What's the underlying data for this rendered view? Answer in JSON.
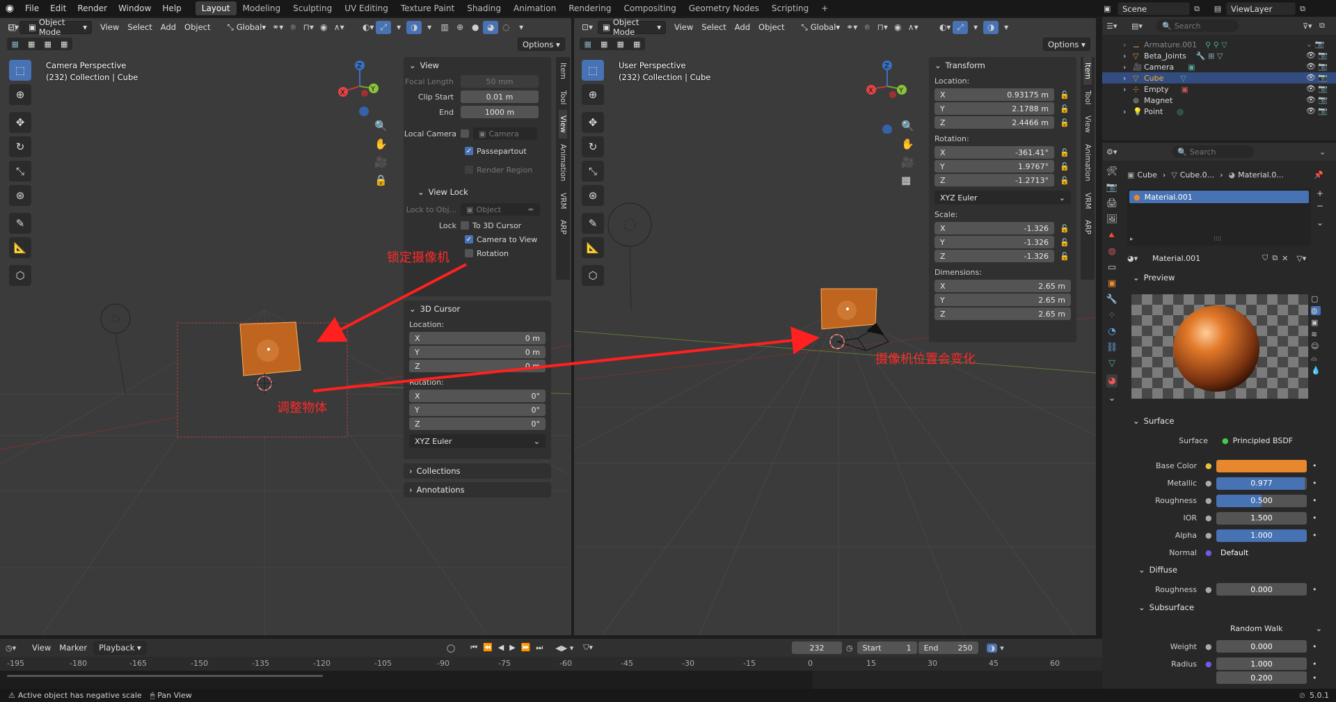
{
  "topbar": {
    "menus": [
      "File",
      "Edit",
      "Render",
      "Window",
      "Help"
    ],
    "workspaces": [
      "Layout",
      "Modeling",
      "Sculpting",
      "UV Editing",
      "Texture Paint",
      "Shading",
      "Animation",
      "Rendering",
      "Compositing",
      "Geometry Nodes",
      "Scripting"
    ],
    "active_workspace": "Layout",
    "add_tab": "+",
    "scene": "Scene",
    "view_layer": "ViewLayer"
  },
  "left_viewport": {
    "mode": "Object Mode",
    "menus": [
      "View",
      "Select",
      "Add",
      "Object"
    ],
    "orientation": "Global",
    "options": "Options",
    "info_line1": "Camera Perspective",
    "info_line2": "(232) Collection | Cube",
    "npanel": {
      "view_header": "View",
      "focal_length_label": "Focal Length",
      "focal_length": "50 mm",
      "clip_start_label": "Clip Start",
      "clip_start": "0.01 m",
      "end_label": "End",
      "end": "1000 m",
      "local_camera_label": "Local Camera",
      "camera_placeholder": "Camera",
      "passepartout": "Passepartout",
      "render_region": "Render Region",
      "view_lock_header": "View Lock",
      "lock_to_obj_label": "Lock to Obj...",
      "object_placeholder": "Object",
      "lock_label": "Lock",
      "to_3d_cursor": "To 3D Cursor",
      "camera_to_view": "Camera to View",
      "rotation": "Rotation",
      "cursor_header": "3D Cursor",
      "location_label": "Location:",
      "loc_x": "0 m",
      "loc_y": "0 m",
      "loc_z": "0 m",
      "rotation_label": "Rotation:",
      "rot_x": "0°",
      "rot_y": "0°",
      "rot_z": "0°",
      "euler": "XYZ Euler",
      "collections": "Collections",
      "annotations": "Annotations"
    },
    "tabs": [
      "Item",
      "Tool",
      "View",
      "Animation",
      "VRM",
      "ARP"
    ],
    "active_tab": "View"
  },
  "right_viewport": {
    "mode": "Object Mode",
    "menus": [
      "View",
      "Select",
      "Add",
      "Object"
    ],
    "orientation": "Global",
    "options": "Options",
    "info_line1": "User Perspective",
    "info_line2": "(232) Collection | Cube",
    "transform": {
      "header": "Transform",
      "location_label": "Location:",
      "loc_x": "0.93175 m",
      "loc_y": "2.1788 m",
      "loc_z": "2.4466 m",
      "rotation_label": "Rotation:",
      "rot_x": "-361.41°",
      "rot_y": "1.9767°",
      "rot_z": "-1.2713°",
      "euler": "XYZ Euler",
      "scale_label": "Scale:",
      "sc_x": "-1.326",
      "sc_y": "-1.326",
      "sc_z": "-1.326",
      "dim_label": "Dimensions:",
      "dim_x": "2.65 m",
      "dim_y": "2.65 m",
      "dim_z": "2.65 m"
    },
    "tabs": [
      "Item",
      "Tool",
      "View",
      "Animation",
      "VRM",
      "ARP"
    ],
    "active_tab": "Item"
  },
  "annotations": {
    "lock_camera": "锁定摄像机",
    "adjust_object": "调整物体",
    "camera_changes": "摄像机位置会变化"
  },
  "outliner": {
    "search_placeholder": "Search",
    "items": [
      "Armature.001",
      "Beta_Joints",
      "Camera",
      "Cube",
      "Empty",
      "Magnet",
      "Point"
    ],
    "selected": "Cube"
  },
  "properties": {
    "search_placeholder": "Search",
    "breadcrumb": [
      "Cube",
      "Cube.0...",
      "Material.0..."
    ],
    "material_slot": "Material.001",
    "material_name": "Material.001",
    "preview_header": "Preview",
    "surface_header": "Surface",
    "surface_label": "Surface",
    "surface_value": "Principled BSDF",
    "rows": [
      {
        "label": "Base Color",
        "value": "",
        "type": "color"
      },
      {
        "label": "Metallic",
        "value": "0.977",
        "type": "slider",
        "fill": 0.977
      },
      {
        "label": "Roughness",
        "value": "0.500",
        "type": "slider",
        "fill": 0.5
      },
      {
        "label": "IOR",
        "value": "1.500",
        "type": "plain"
      },
      {
        "label": "Alpha",
        "value": "1.000",
        "type": "slider",
        "fill": 1.0
      },
      {
        "label": "Normal",
        "value": "Default",
        "type": "text"
      }
    ],
    "diffuse_header": "Diffuse",
    "diffuse_roughness_label": "Roughness",
    "diffuse_roughness": "0.000",
    "subsurface_header": "Subsurface",
    "subsurface_method": "Random Walk",
    "weight_label": "Weight",
    "weight": "0.000",
    "radius_label": "Radius",
    "radius_1": "1.000",
    "radius_2": "0.200",
    "base_color_hex": "#e8882e"
  },
  "timeline": {
    "menus": [
      "View",
      "Marker"
    ],
    "playback": "Playback",
    "current_frame": "232",
    "start_label": "Start",
    "start": "1",
    "end_label": "End",
    "end": "250",
    "ticks": [
      "-195",
      "-180",
      "-165",
      "-150",
      "-135",
      "-120",
      "-105",
      "-90",
      "-75",
      "-60",
      "-45",
      "-30",
      "-15",
      "0",
      "15",
      "30",
      "45",
      "60"
    ]
  },
  "statusbar": {
    "warning": "Active object has negative scale",
    "pan": "Pan View",
    "version": "5.0.1"
  }
}
